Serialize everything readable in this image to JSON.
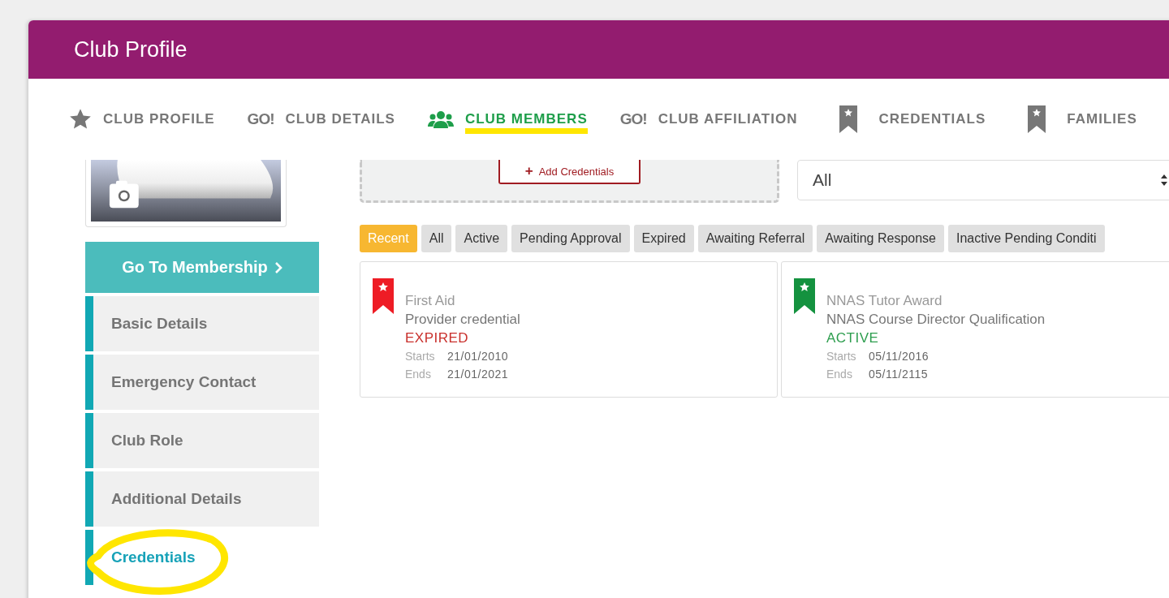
{
  "header": {
    "title": "Club Profile"
  },
  "tabs": [
    {
      "label": "CLUB PROFILE",
      "kind": "star",
      "selected": false
    },
    {
      "label": "CLUB DETAILS",
      "kind": "go",
      "icon_text": "GO!",
      "selected": false
    },
    {
      "label": "CLUB MEMBERS",
      "kind": "people",
      "selected": true
    },
    {
      "label": "CLUB AFFILIATION",
      "kind": "go",
      "icon_text": "GO!",
      "selected": false
    },
    {
      "label": "CREDENTIALS",
      "kind": "bookmark",
      "selected": false
    },
    {
      "label": "FAMILIES",
      "kind": "bookmark",
      "selected": false
    }
  ],
  "sidebar": {
    "membership_button": "Go To Membership",
    "items": [
      {
        "label": "Basic Details",
        "selected": false
      },
      {
        "label": "Emergency Contact",
        "selected": false
      },
      {
        "label": "Club Role",
        "selected": false
      },
      {
        "label": "Additional Details",
        "selected": false
      },
      {
        "label": "Credentials",
        "selected": true
      }
    ]
  },
  "add_button": {
    "icon": "+",
    "label": "Add Credentials"
  },
  "filter_select": {
    "value": "All"
  },
  "filters": [
    {
      "label": "Recent",
      "selected": true
    },
    {
      "label": "All",
      "selected": false
    },
    {
      "label": "Active",
      "selected": false
    },
    {
      "label": "Pending Approval",
      "selected": false
    },
    {
      "label": "Expired",
      "selected": false
    },
    {
      "label": "Awaiting Referral",
      "selected": false
    },
    {
      "label": "Awaiting Response",
      "selected": false
    },
    {
      "label": "Inactive Pending Conditi",
      "selected": false
    }
  ],
  "credentials": [
    {
      "title": "First Aid",
      "subtitle": "Provider credential",
      "status": "EXPIRED",
      "kind": "expired",
      "color": "#ee1c25",
      "starts_label": "Starts",
      "starts": "21/01/2010",
      "ends_label": "Ends",
      "ends": "21/01/2021"
    },
    {
      "title": "NNAS Tutor Award",
      "subtitle": "NNAS Course Director Qualification",
      "status": "ACTIVE",
      "kind": "active",
      "color": "#14923f",
      "starts_label": "Starts",
      "starts": "05/11/2016",
      "ends_label": "Ends",
      "ends": "05/11/2115"
    }
  ]
}
